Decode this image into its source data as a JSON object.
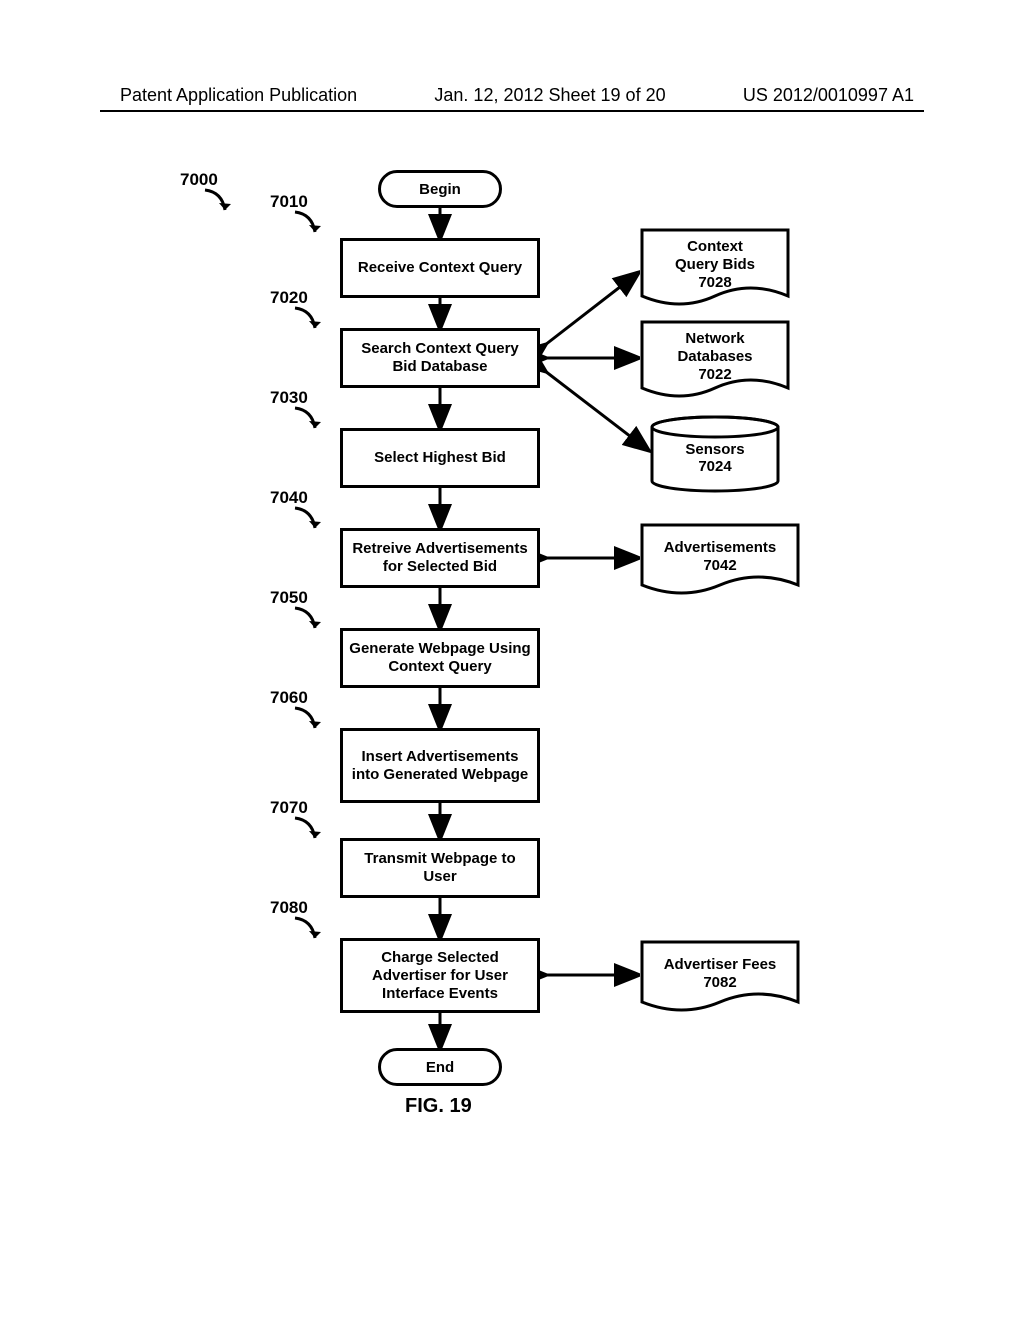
{
  "header": {
    "left": "Patent Application Publication",
    "center": "Jan. 12, 2012  Sheet 19 of 20",
    "right": "US 2012/0010997 A1"
  },
  "labels": {
    "n7000": "7000",
    "n7010": "7010",
    "n7020": "7020",
    "n7022": "7022",
    "n7024": "7024",
    "n7028": "7028",
    "n7030": "7030",
    "n7040": "7040",
    "n7042": "7042",
    "n7050": "7050",
    "n7060": "7060",
    "n7070": "7070",
    "n7080": "7080",
    "n7082": "7082"
  },
  "nodes": {
    "begin": "Begin",
    "receive": "Receive Context Query",
    "search": "Search Context Query Bid Database",
    "select": "Select Highest Bid",
    "retrieve": "Retreive Advertisements for Selected Bid",
    "generate": "Generate Webpage Using Context Query",
    "insert": "Insert Advertisements into  Generated Webpage",
    "transmit": "Transmit Webpage to User",
    "charge": "Charge Selected Advertiser for User Interface Events",
    "end": "End",
    "context_bids_l1": "Context",
    "context_bids_l2": "Query Bids",
    "network_db_l1": "Network",
    "network_db_l2": "Databases",
    "sensors": "Sensors",
    "advertisements": "Advertisements",
    "adv_fees": "Advertiser Fees"
  },
  "figure": "FIG. 19",
  "chart_data": {
    "type": "flowchart",
    "title": "FIG. 19",
    "nodes": [
      {
        "id": "7000",
        "type": "label",
        "text": "7000"
      },
      {
        "id": "begin",
        "type": "terminator",
        "text": "Begin"
      },
      {
        "id": "7010",
        "type": "process",
        "text": "Receive Context Query"
      },
      {
        "id": "7020",
        "type": "process",
        "text": "Search Context Query Bid Database"
      },
      {
        "id": "7022",
        "type": "datastore-document",
        "text": "Network Databases 7022"
      },
      {
        "id": "7024",
        "type": "datastore-drum",
        "text": "Sensors 7024"
      },
      {
        "id": "7028",
        "type": "datastore-document",
        "text": "Context Query Bids 7028"
      },
      {
        "id": "7030",
        "type": "process",
        "text": "Select Highest Bid"
      },
      {
        "id": "7040",
        "type": "process",
        "text": "Retreive Advertisements for Selected Bid"
      },
      {
        "id": "7042",
        "type": "datastore-document",
        "text": "Advertisements 7042"
      },
      {
        "id": "7050",
        "type": "process",
        "text": "Generate Webpage Using Context Query"
      },
      {
        "id": "7060",
        "type": "process",
        "text": "Insert Advertisements into Generated Webpage"
      },
      {
        "id": "7070",
        "type": "process",
        "text": "Transmit Webpage to User"
      },
      {
        "id": "7080",
        "type": "process",
        "text": "Charge Selected Advertiser for User Interface Events"
      },
      {
        "id": "7082",
        "type": "datastore-document",
        "text": "Advertiser Fees 7082"
      },
      {
        "id": "end",
        "type": "terminator",
        "text": "End"
      }
    ],
    "edges": [
      {
        "from": "begin",
        "to": "7010",
        "dir": "forward"
      },
      {
        "from": "7010",
        "to": "7020",
        "dir": "forward"
      },
      {
        "from": "7020",
        "to": "7030",
        "dir": "forward"
      },
      {
        "from": "7030",
        "to": "7040",
        "dir": "forward"
      },
      {
        "from": "7040",
        "to": "7050",
        "dir": "forward"
      },
      {
        "from": "7050",
        "to": "7060",
        "dir": "forward"
      },
      {
        "from": "7060",
        "to": "7070",
        "dir": "forward"
      },
      {
        "from": "7070",
        "to": "7080",
        "dir": "forward"
      },
      {
        "from": "7080",
        "to": "end",
        "dir": "forward"
      },
      {
        "from": "7028",
        "to": "7020",
        "dir": "both"
      },
      {
        "from": "7022",
        "to": "7020",
        "dir": "both"
      },
      {
        "from": "7024",
        "to": "7020",
        "dir": "both"
      },
      {
        "from": "7042",
        "to": "7040",
        "dir": "both"
      },
      {
        "from": "7082",
        "to": "7080",
        "dir": "both"
      }
    ]
  }
}
